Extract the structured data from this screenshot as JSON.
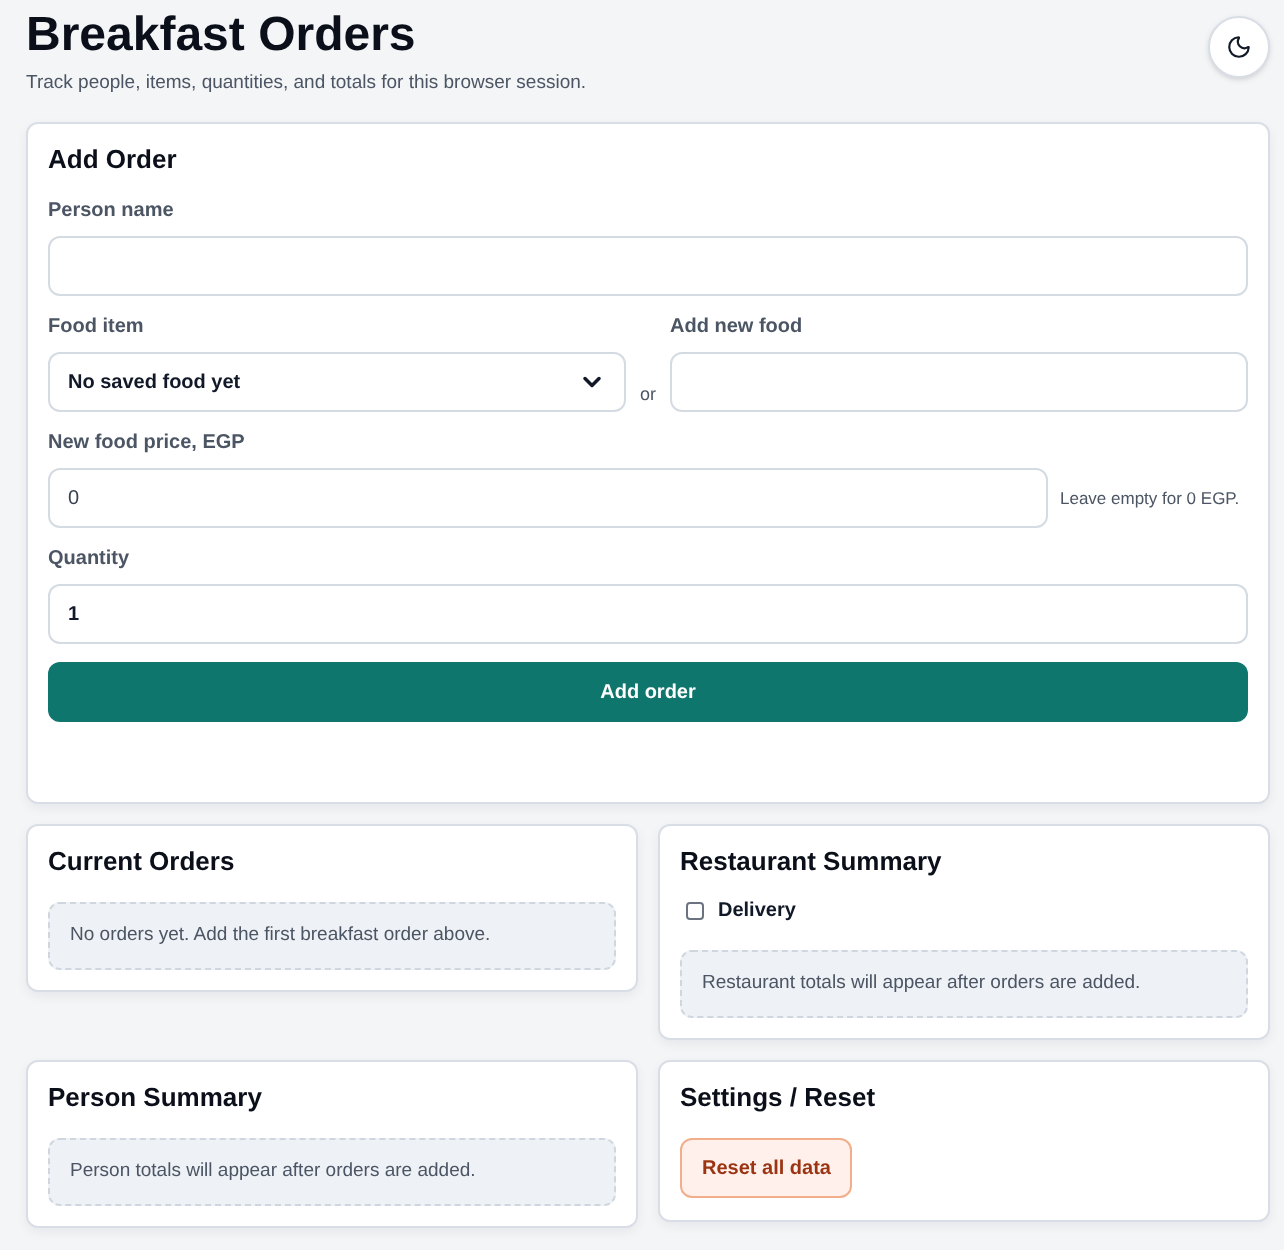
{
  "header": {
    "title": "Breakfast Orders",
    "subtitle": "Track people, items, quantities, and totals for this browser session."
  },
  "add_order": {
    "title": "Add Order",
    "person_name": {
      "label": "Person name"
    },
    "food_item": {
      "label": "Food item",
      "value": "No saved food yet"
    },
    "separator": "or",
    "new_food": {
      "label": "Add new food"
    },
    "new_food_price": {
      "label": "New food price, EGP",
      "placeholder": "0",
      "hint": "Leave empty for 0 EGP."
    },
    "quantity": {
      "label": "Quantity",
      "value": "1"
    },
    "submit_button": "Add order"
  },
  "current_orders": {
    "title": "Current Orders",
    "empty_message": "No orders yet. Add the first breakfast order above."
  },
  "restaurant_summary": {
    "title": "Restaurant Summary",
    "delivery": {
      "label": "Delivery",
      "checked": false
    },
    "empty_message": "Restaurant totals will appear after orders are added."
  },
  "person_summary": {
    "title": "Person Summary",
    "empty_message": "Person totals will appear after orders are added."
  },
  "settings": {
    "title": "Settings / Reset",
    "reset_button": "Reset all data"
  }
}
